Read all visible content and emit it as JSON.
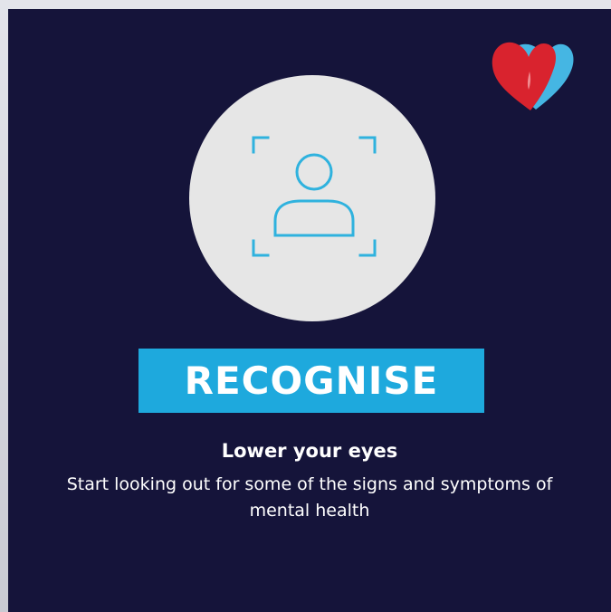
{
  "card": {
    "title": "RECOGNISE",
    "subtitle": "Lower your eyes",
    "body": "Start looking out for some of the signs and symptoms of mental health"
  },
  "icons": {
    "logo": "heart-logo-icon",
    "main": "face-scan-icon"
  },
  "colors": {
    "background": "#15143a",
    "accent": "#1ea9dd",
    "circle": "#e6e6e6",
    "heart_red": "#d9232e",
    "heart_blue": "#45b6e3",
    "text": "#ffffff"
  }
}
